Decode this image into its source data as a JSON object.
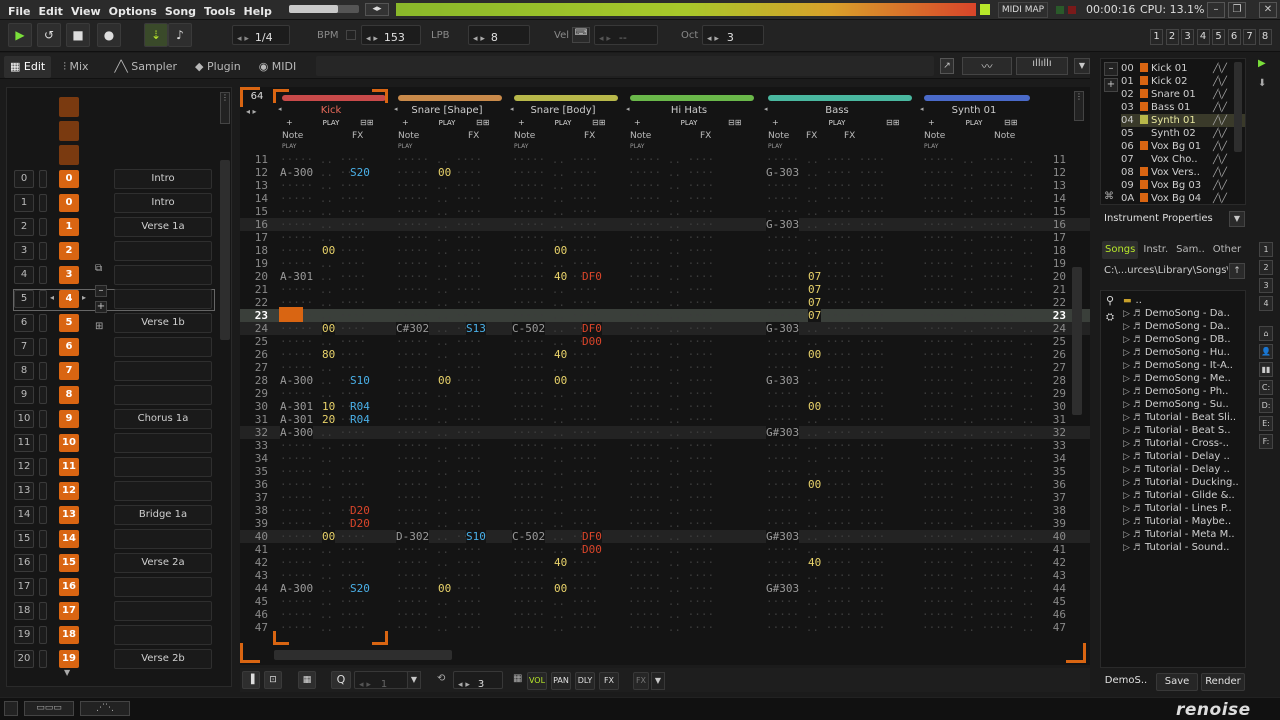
{
  "menu": [
    "File",
    "Edit",
    "View",
    "Options",
    "Song",
    "Tools",
    "Help"
  ],
  "top_right": {
    "midi_map": "MIDI MAP",
    "time": "00:00:16",
    "cpu": "CPU: 13.1%"
  },
  "transport": {
    "fraction": "1/4",
    "bpm_label": "BPM",
    "bpm": "153",
    "lpb_label": "LPB",
    "lpb": "8",
    "vel_label": "Vel",
    "vel": "--",
    "oct_label": "Oct",
    "oct": "3",
    "track_buttons": [
      "1",
      "2",
      "3",
      "4",
      "5",
      "6",
      "7",
      "8"
    ]
  },
  "tabs": [
    "Edit",
    "Mix",
    "Sampler",
    "Plugin",
    "MIDI"
  ],
  "sequencer": {
    "rows": [
      {
        "num": "0",
        "pat": "0",
        "section": "Intro"
      },
      {
        "num": "1",
        "pat": "0",
        "section": "Intro"
      },
      {
        "num": "2",
        "pat": "1",
        "section": "Verse 1a"
      },
      {
        "num": "3",
        "pat": "2",
        "section": ""
      },
      {
        "num": "4",
        "pat": "3",
        "section": ""
      },
      {
        "num": "5",
        "pat": "4",
        "section": ""
      },
      {
        "num": "6",
        "pat": "5",
        "section": "Verse 1b"
      },
      {
        "num": "7",
        "pat": "6",
        "section": ""
      },
      {
        "num": "8",
        "pat": "7",
        "section": ""
      },
      {
        "num": "9",
        "pat": "8",
        "section": ""
      },
      {
        "num": "10",
        "pat": "9",
        "section": "Chorus 1a"
      },
      {
        "num": "11",
        "pat": "10",
        "section": ""
      },
      {
        "num": "12",
        "pat": "11",
        "section": ""
      },
      {
        "num": "13",
        "pat": "12",
        "section": ""
      },
      {
        "num": "14",
        "pat": "13",
        "section": "Bridge 1a"
      },
      {
        "num": "15",
        "pat": "14",
        "section": ""
      },
      {
        "num": "16",
        "pat": "15",
        "section": "Verse 2a"
      },
      {
        "num": "17",
        "pat": "16",
        "section": ""
      },
      {
        "num": "18",
        "pat": "17",
        "section": ""
      },
      {
        "num": "19",
        "pat": "18",
        "section": ""
      },
      {
        "num": "20",
        "pat": "19",
        "section": "Verse 2b"
      }
    ]
  },
  "pattern": {
    "lines": "64",
    "current_line": "23",
    "tracks": [
      {
        "name": "Kick",
        "color": "#c94a4a",
        "cols": [
          "Note",
          "FX"
        ],
        "sub": "PLAY"
      },
      {
        "name": "Snare [Shape]",
        "color": "#c98a4a",
        "cols": [
          "Note",
          "FX"
        ],
        "sub": "PLAY"
      },
      {
        "name": "Snare [Body]",
        "color": "#b8b84a",
        "cols": [
          "Note",
          "FX"
        ],
        "sub": "PLAY"
      },
      {
        "name": "Hi Hats",
        "color": "#6ab84a",
        "cols": [
          "Note",
          "FX"
        ],
        "sub": "PLAY"
      },
      {
        "name": "Bass",
        "color": "#4ab8a0",
        "cols": [
          "Note",
          "FX",
          "FX"
        ],
        "sub": "PLAY"
      },
      {
        "name": "Synth 01",
        "color": "#4a6ac9",
        "cols": [
          "Note",
          "Note"
        ],
        "sub": "PLAY"
      }
    ],
    "row_numbers": [
      "11",
      "12",
      "13",
      "14",
      "15",
      "16",
      "17",
      "18",
      "19",
      "20",
      "21",
      "22",
      "23",
      "24",
      "25",
      "26",
      "27",
      "28",
      "29",
      "30",
      "31",
      "32",
      "33",
      "34",
      "35",
      "36",
      "37",
      "38",
      "39",
      "40",
      "41",
      "42",
      "43",
      "44",
      "45",
      "46",
      "47"
    ],
    "cells": [
      {
        "r": 1,
        "t": 0,
        "c": "n",
        "v": "A-300"
      },
      {
        "r": 1,
        "t": 0,
        "c": "f",
        "v": "S20"
      },
      {
        "r": 1,
        "t": 1,
        "c": "v",
        "v": "00"
      },
      {
        "r": 1,
        "t": 4,
        "c": "n",
        "v": "G-303"
      },
      {
        "r": 5,
        "t": 4,
        "c": "n",
        "v": "G-303"
      },
      {
        "r": 7,
        "t": 0,
        "c": "v",
        "v": "00"
      },
      {
        "r": 7,
        "t": 2,
        "c": "v",
        "v": "00"
      },
      {
        "r": 9,
        "t": 0,
        "c": "n",
        "v": "A-301"
      },
      {
        "r": 9,
        "t": 2,
        "c": "v",
        "v": "40"
      },
      {
        "r": 9,
        "t": 2,
        "c": "f",
        "v": "DF0"
      },
      {
        "r": 9,
        "t": 4,
        "c": "v",
        "v": "07"
      },
      {
        "r": 10,
        "t": 4,
        "c": "v",
        "v": "07"
      },
      {
        "r": 11,
        "t": 4,
        "c": "v",
        "v": "07"
      },
      {
        "r": 12,
        "t": 4,
        "c": "v",
        "v": "07"
      },
      {
        "r": 13,
        "t": 0,
        "c": "v",
        "v": "00"
      },
      {
        "r": 13,
        "t": 1,
        "c": "n",
        "v": "C#302"
      },
      {
        "r": 13,
        "t": 1,
        "c": "f",
        "v": "S13"
      },
      {
        "r": 13,
        "t": 2,
        "c": "n",
        "v": "C-502"
      },
      {
        "r": 13,
        "t": 2,
        "c": "f",
        "v": "DF0"
      },
      {
        "r": 13,
        "t": 4,
        "c": "n",
        "v": "G-303"
      },
      {
        "r": 14,
        "t": 2,
        "c": "f",
        "v": "D00"
      },
      {
        "r": 15,
        "t": 0,
        "c": "v",
        "v": "80"
      },
      {
        "r": 15,
        "t": 2,
        "c": "v",
        "v": "40"
      },
      {
        "r": 15,
        "t": 4,
        "c": "v",
        "v": "00"
      },
      {
        "r": 17,
        "t": 0,
        "c": "n",
        "v": "A-300"
      },
      {
        "r": 17,
        "t": 0,
        "c": "f",
        "v": "S10"
      },
      {
        "r": 17,
        "t": 1,
        "c": "v",
        "v": "00"
      },
      {
        "r": 17,
        "t": 2,
        "c": "v",
        "v": "00"
      },
      {
        "r": 17,
        "t": 4,
        "c": "n",
        "v": "G-303"
      },
      {
        "r": 19,
        "t": 0,
        "c": "n",
        "v": "A-301"
      },
      {
        "r": 19,
        "t": 0,
        "c": "v",
        "v": "10"
      },
      {
        "r": 19,
        "t": 0,
        "c": "f",
        "v": "R04"
      },
      {
        "r": 19,
        "t": 4,
        "c": "v",
        "v": "00"
      },
      {
        "r": 20,
        "t": 0,
        "c": "n",
        "v": "A-301"
      },
      {
        "r": 20,
        "t": 0,
        "c": "v",
        "v": "20"
      },
      {
        "r": 20,
        "t": 0,
        "c": "f",
        "v": "R04"
      },
      {
        "r": 21,
        "t": 0,
        "c": "n",
        "v": "A-300"
      },
      {
        "r": 21,
        "t": 4,
        "c": "n",
        "v": "G#303"
      },
      {
        "r": 25,
        "t": 4,
        "c": "v",
        "v": "00"
      },
      {
        "r": 27,
        "t": 0,
        "c": "f",
        "v": "D20"
      },
      {
        "r": 28,
        "t": 0,
        "c": "f",
        "v": "D20"
      },
      {
        "r": 29,
        "t": 0,
        "c": "v",
        "v": "00"
      },
      {
        "r": 29,
        "t": 1,
        "c": "n",
        "v": "D-302"
      },
      {
        "r": 29,
        "t": 1,
        "c": "f",
        "v": "S10"
      },
      {
        "r": 29,
        "t": 2,
        "c": "n",
        "v": "C-502"
      },
      {
        "r": 29,
        "t": 2,
        "c": "f",
        "v": "DF0"
      },
      {
        "r": 29,
        "t": 4,
        "c": "n",
        "v": "G#303"
      },
      {
        "r": 30,
        "t": 2,
        "c": "f",
        "v": "D00"
      },
      {
        "r": 31,
        "t": 2,
        "c": "v",
        "v": "40"
      },
      {
        "r": 31,
        "t": 4,
        "c": "v",
        "v": "40"
      },
      {
        "r": 33,
        "t": 0,
        "c": "n",
        "v": "A-300"
      },
      {
        "r": 33,
        "t": 0,
        "c": "f",
        "v": "S20"
      },
      {
        "r": 33,
        "t": 1,
        "c": "v",
        "v": "00"
      },
      {
        "r": 33,
        "t": 2,
        "c": "v",
        "v": "00"
      },
      {
        "r": 33,
        "t": 4,
        "c": "n",
        "v": "G#303"
      }
    ]
  },
  "instruments": [
    {
      "idx": "00",
      "name": "Kick 01",
      "color": "#d96512"
    },
    {
      "idx": "01",
      "name": "Kick 02",
      "color": "#d96512"
    },
    {
      "idx": "02",
      "name": "Snare 01",
      "color": "#d96512"
    },
    {
      "idx": "03",
      "name": "Bass 01",
      "color": "#d96512"
    },
    {
      "idx": "04",
      "name": "Synth 01",
      "color": "#b8b84a"
    },
    {
      "idx": "05",
      "name": "Synth 02",
      "color": ""
    },
    {
      "idx": "06",
      "name": "Vox Bg 01",
      "color": "#d96512"
    },
    {
      "idx": "07",
      "name": "Vox Cho..",
      "color": ""
    },
    {
      "idx": "08",
      "name": "Vox Vers..",
      "color": "#d96512"
    },
    {
      "idx": "09",
      "name": "Vox Bg 03",
      "color": "#d96512"
    },
    {
      "idx": "0A",
      "name": "Vox Bg 04",
      "color": "#d96512"
    }
  ],
  "inst_props": "Instrument Properties",
  "browser_tabs": [
    "Songs",
    "Instr.",
    "Sam..",
    "Other"
  ],
  "browser_path": "C:\\...urces\\Library\\Songs\\",
  "browser_items": [
    "..",
    "DemoSong - Da..",
    "DemoSong - Da..",
    "DemoSong - DB..",
    "DemoSong - Hu..",
    "DemoSong - It-A..",
    "DemoSong - Me..",
    "DemoSong - Ph..",
    "DemoSong - Su..",
    "Tutorial - Beat Sli..",
    "Tutorial - Beat S..",
    "Tutorial - Cross-..",
    "Tutorial - Delay ..",
    "Tutorial - Delay ..",
    "Tutorial - Ducking..",
    "Tutorial - Glide &..",
    "Tutorial - Lines P..",
    "Tutorial - Maybe..",
    "Tutorial - Meta M..",
    "Tutorial - Sound.."
  ],
  "bottom_bar": {
    "q_label": "Q",
    "q_val": "1",
    "step": "3",
    "vol": "VOL",
    "pan": "PAN",
    "dly": "DLY",
    "fx": "FX",
    "fx2": "FX"
  },
  "browser_bottom": {
    "demo": "DemoS..",
    "save": "Save",
    "render": "Render"
  },
  "logo": "renoise",
  "colors": {
    "accent": "#d96512",
    "note": "#9a9a9a",
    "vol": "#e8d26a",
    "fx": "#4ab0e8",
    "fx_red": "#d9452a",
    "dots": "#3c3c3c"
  }
}
